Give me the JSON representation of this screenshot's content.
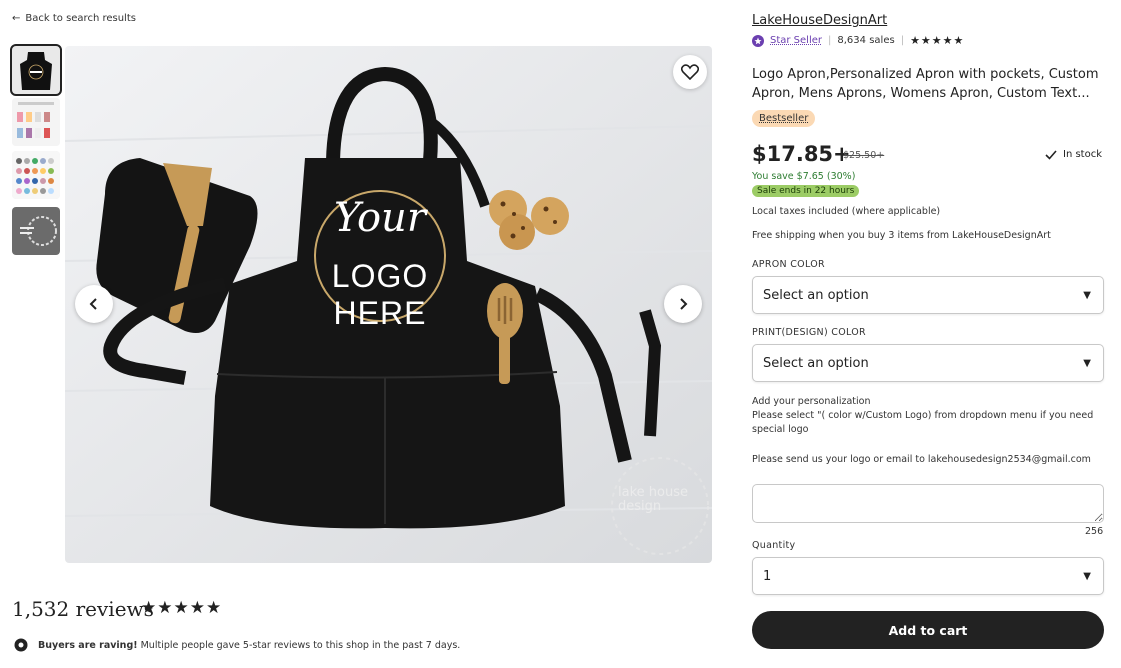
{
  "nav": {
    "back_label": "Back to search results"
  },
  "gallery": {
    "overlay_line1": "Your",
    "overlay_line2": "LOGO HERE",
    "watermark": "lake house design"
  },
  "reviews": {
    "count_label": "1,532 reviews",
    "stars": "★★★★★",
    "raving_bold": "Buyers are raving!",
    "raving_text": "Multiple people gave 5-star reviews to this shop in the past 7 days."
  },
  "shop": {
    "name": "LakeHouseDesignArt",
    "star_seller_label": "Star Seller",
    "sales": "8,634 sales",
    "stars": "★★★★★"
  },
  "listing": {
    "title": "Logo Apron,Personalized Apron with pockets, Custom Apron, Mens Aprons, Womens Apron, Custom Text...",
    "bestseller": "Bestseller",
    "price": "$17.85+",
    "original_price": "$25.50+",
    "stock": "In stock",
    "you_save": "You save $7.65 (30%)",
    "sale_ends": "Sale ends in 22 hours",
    "taxes": "Local taxes included (where applicable)",
    "shipping": "Free shipping when you buy 3 items from LakeHouseDesignArt"
  },
  "options": {
    "apron_color_label": "APRON COLOR",
    "apron_color_value": "Select an option",
    "print_color_label": "PRINT(DESIGN) COLOR",
    "print_color_value": "Select an option"
  },
  "personalization": {
    "label": "Add your personalization",
    "instructions": "Please select \"( color w/Custom Logo) from dropdown menu if you need special logo",
    "hint": "Please send us your logo or email to lakehousedesign2534@gmail.com",
    "char_limit": "256"
  },
  "quantity": {
    "label": "Quantity",
    "value": "1"
  },
  "cart": {
    "add_label": "Add to cart"
  },
  "colors": {
    "accent_purple": "#6b3fb0",
    "sale_green": "#9ccc65",
    "save_green": "#2e7d32",
    "bestseller_bg": "#fbd9b4"
  }
}
